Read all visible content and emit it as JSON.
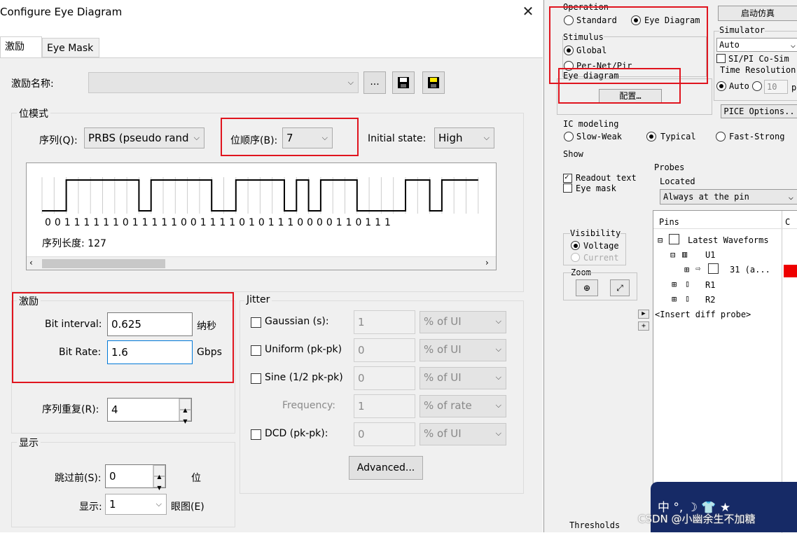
{
  "dialog": {
    "title": "Configure Eye Diagram",
    "close": "✕",
    "tabs": [
      "激励",
      "Eye Mask"
    ],
    "stim_name_label": "激励名称:",
    "stim_name_value": "",
    "ellipsis": "...",
    "bit_mode": {
      "title": "位模式",
      "seq_label": "序列(Q):",
      "seq_value": "PRBS (pseudo rand",
      "order_label": "位顺序(B):",
      "order_value": "7",
      "init_label": "Initial state:",
      "init_value": "High",
      "bits": "0 0 1 1 1 1 1 1 0 1 1 1 1 1 0 0 1 1 1 1 0 1 0 1 1 1 0 0 0 0 1 1 0 1 1 1",
      "bit_values": [
        0,
        0,
        1,
        1,
        1,
        1,
        1,
        1,
        0,
        1,
        1,
        1,
        1,
        1,
        0,
        0,
        1,
        1,
        1,
        1,
        0,
        1,
        0,
        1,
        1,
        1,
        0,
        0,
        0,
        0,
        1,
        1,
        0,
        1,
        1,
        1
      ],
      "seq_len": "序列长度: 127"
    },
    "stimulus": {
      "title": "激励",
      "bit_interval_label": "Bit interval:",
      "bit_interval": "0.625",
      "bit_interval_unit": "纳秒",
      "bit_rate_label": "Bit Rate:",
      "bit_rate": "1.6",
      "bit_rate_unit": "Gbps",
      "repeat_label": "序列重复(R):",
      "repeat": "4"
    },
    "jitter": {
      "title": "Jitter",
      "rows": [
        {
          "label": "Gaussian (s):",
          "value": "1",
          "unit": "% of UI",
          "check": true
        },
        {
          "label": "Uniform (pk-pk)",
          "value": "0",
          "unit": "% of UI",
          "check": true
        },
        {
          "label": "Sine (1/2 pk-pk)",
          "value": "0",
          "unit": "% of UI",
          "check": true
        },
        {
          "label": "Frequency:",
          "value": "1",
          "unit": "% of rate",
          "check": false
        },
        {
          "label": "DCD (pk-pk):",
          "value": "0",
          "unit": "% of UI",
          "check": true
        }
      ],
      "advanced": "Advanced..."
    },
    "display": {
      "title": "显示",
      "skip_label": "跳过前(S):",
      "skip": "0",
      "skip_unit": "位",
      "show_label": "显示:",
      "show": "1",
      "show_unit": "眼图(E)"
    }
  },
  "right": {
    "operation": "Operation",
    "standard": "Standard",
    "eye": "Eye Diagram",
    "stimulus": "Stimulus",
    "global": "Global",
    "pernet": "Per-Net/Pir",
    "eye_diagram": "Eye diagram",
    "config": "配置…",
    "start_sim": "启动仿真",
    "simulator": "Simulator",
    "sim_value": "Auto",
    "sipi": "SI/PI Co-Sim",
    "time_res": "Time Resolution",
    "auto": "Auto",
    "res_value": "10",
    "res_unit": "p",
    "pice": "PICE Options..",
    "ic": "IC modeling",
    "slow": "Slow-Weak",
    "typ": "Typical",
    "fast": "Fast-Strong",
    "show": "Show",
    "readout": "Readout text",
    "eyemask": "Eye mask",
    "probes": "Probes",
    "located": "Located",
    "loc_value": "Always at the pin",
    "visibility": "Visibility",
    "voltage": "Voltage",
    "current": "Current",
    "zoom": "Zoom",
    "pins": "Pins",
    "col_c": "C",
    "latest": "Latest Waveforms",
    "u1": "U1",
    "pin31": "31 (a...",
    "r1": "R1",
    "r2": "R2",
    "insert": "<Insert diff probe>",
    "thresholds": "Thresholds",
    "watermark": "CSDN @小幽余生不加糖",
    "badge": "中 °, ☽ 👕 ★"
  }
}
